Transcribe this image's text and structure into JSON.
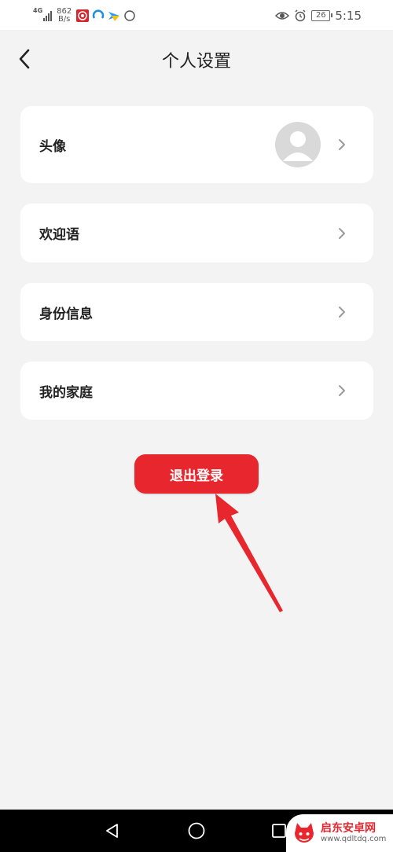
{
  "status_bar": {
    "network_type": "4G",
    "speed_value": "862",
    "speed_unit": "B/s",
    "battery": "26",
    "time": "5:15",
    "icons": [
      "signal-icon",
      "app-notification-icon",
      "app-notification-icon",
      "app-notification-icon",
      "sync-icon",
      "eye-icon",
      "alarm-icon",
      "battery-icon"
    ]
  },
  "header": {
    "title": "个人设置",
    "back_icon": "chevron-left-icon"
  },
  "settings": {
    "items": [
      {
        "label": "头像",
        "has_avatar": true
      },
      {
        "label": "欢迎语"
      },
      {
        "label": "身份信息"
      },
      {
        "label": "我的家庭"
      }
    ]
  },
  "actions": {
    "logout_label": "退出登录"
  },
  "nav_bar": {
    "icons": [
      "back-triangle-icon",
      "home-circle-icon",
      "recents-square-icon"
    ]
  },
  "watermark": {
    "name": "启东安卓网",
    "url": "www.qdltdq.com"
  },
  "colors": {
    "accent": "#e8262e",
    "background": "#f3f3f3",
    "card": "#ffffff",
    "text": "#222222",
    "chevron": "#9a9a9a"
  }
}
